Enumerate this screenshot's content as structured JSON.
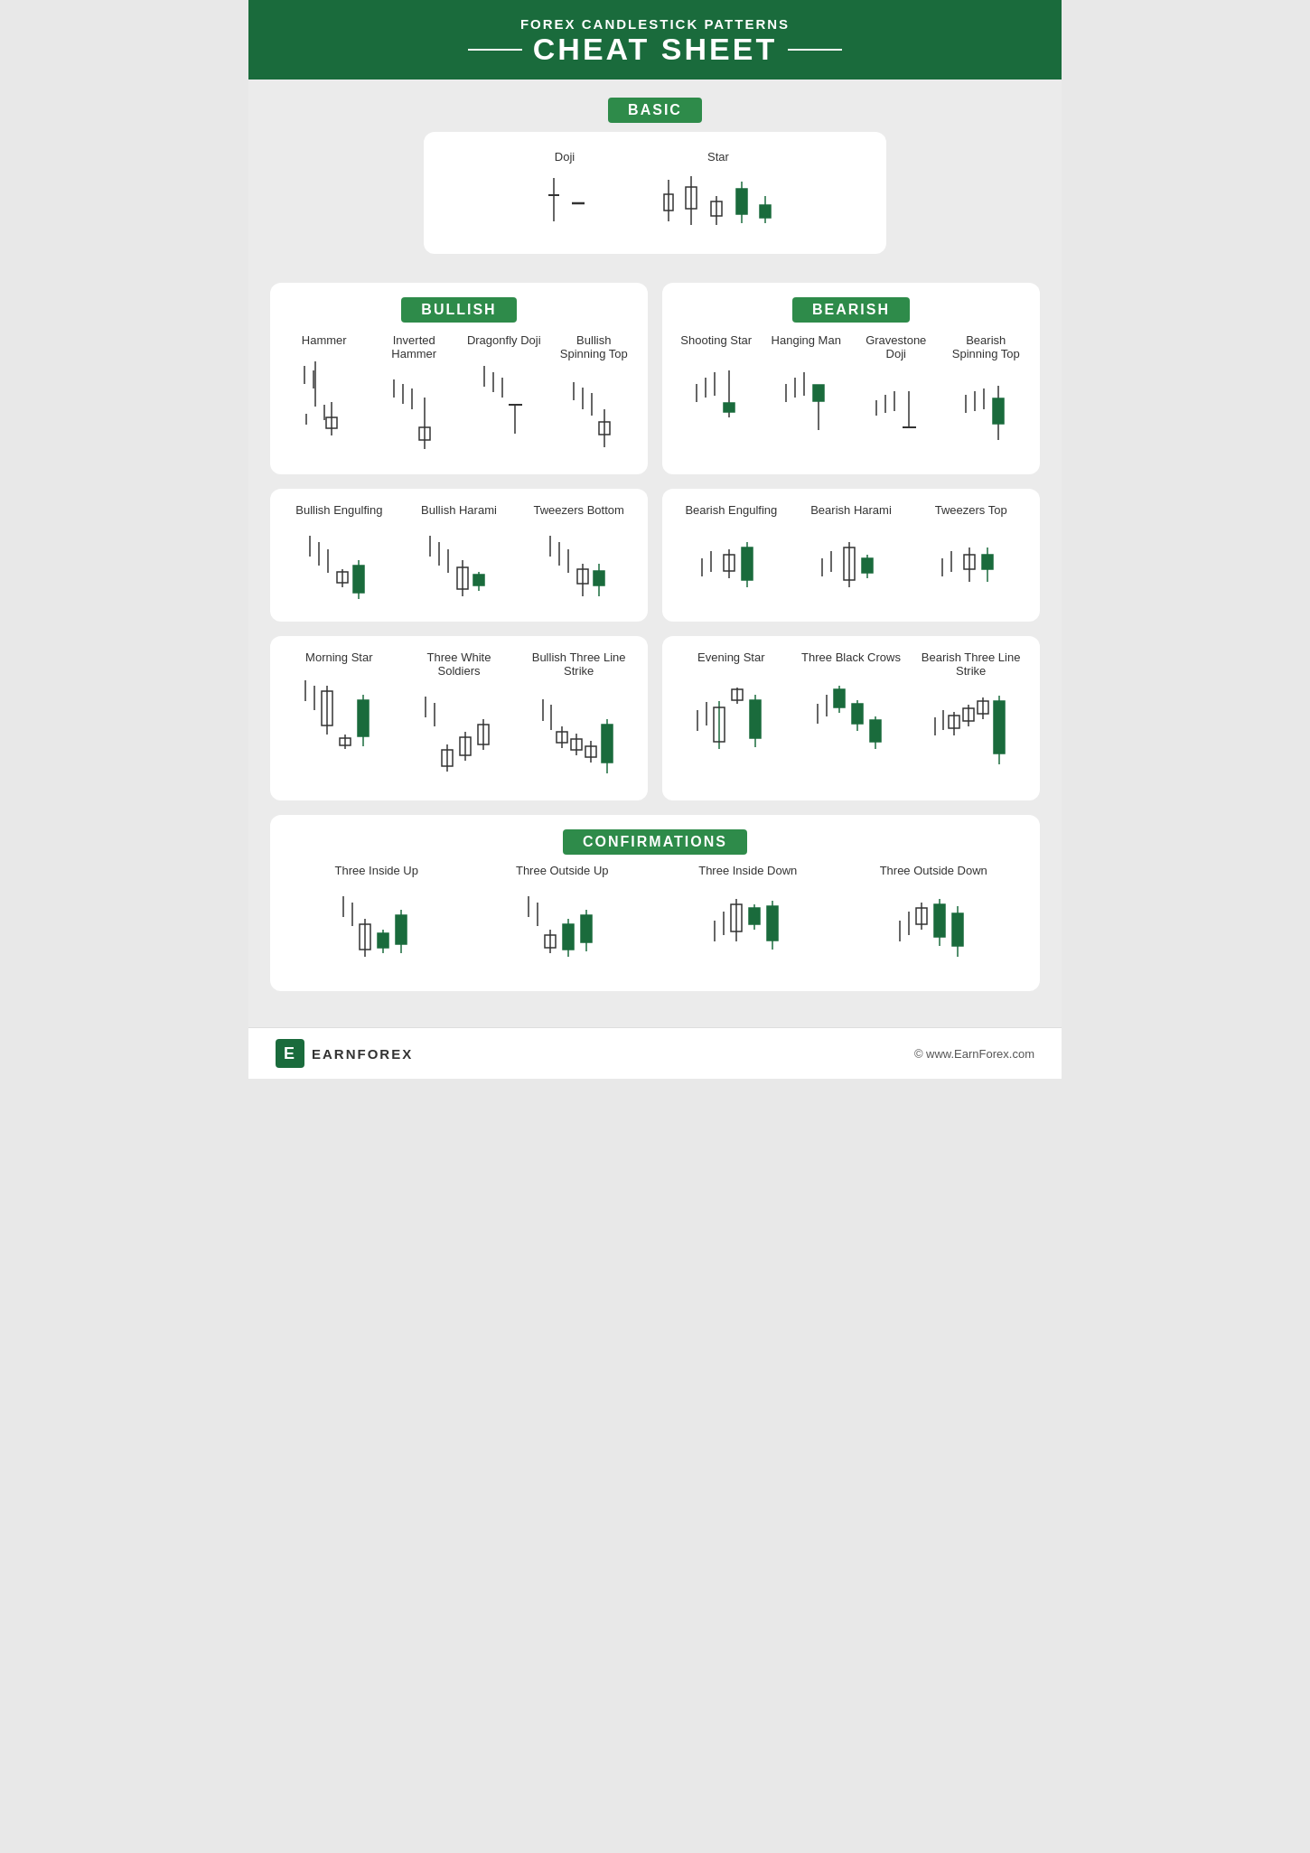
{
  "header": {
    "subtitle": "FOREX CANDLESTICK PATTERNS",
    "title": "CHEAT SHEET"
  },
  "sections": {
    "basic": "BASIC",
    "bullish": "BULLISH",
    "bearish": "BEARISH",
    "confirmations": "CONFIRMATIONS"
  },
  "basic_patterns": {
    "doji": "Doji",
    "star": "Star"
  },
  "bullish_single": [
    "Hammer",
    "Inverted Hammer",
    "Dragonfly Doji",
    "Bullish Spinning Top"
  ],
  "bearish_single": [
    "Shooting Star",
    "Hanging Man",
    "Gravestone Doji",
    "Bearish Spinning Top"
  ],
  "bullish_double": [
    "Bullish Engulfing",
    "Bullish Harami",
    "Tweezers Bottom"
  ],
  "bearish_double": [
    "Bearish Engulfing",
    "Bearish Harami",
    "Tweezers Top"
  ],
  "bullish_triple": [
    "Morning Star",
    "Three White Soldiers",
    "Bullish Three Line Strike"
  ],
  "bearish_triple": [
    "Evening Star",
    "Three Black Crows",
    "Bearish Three Line Strike"
  ],
  "confirmations": [
    "Three Inside Up",
    "Three Outside Up",
    "Three Inside Down",
    "Three Outside Down"
  ],
  "footer": {
    "logo_letter": "E",
    "logo_text": "EARNFOREX",
    "url": "© www.EarnForex.com"
  }
}
